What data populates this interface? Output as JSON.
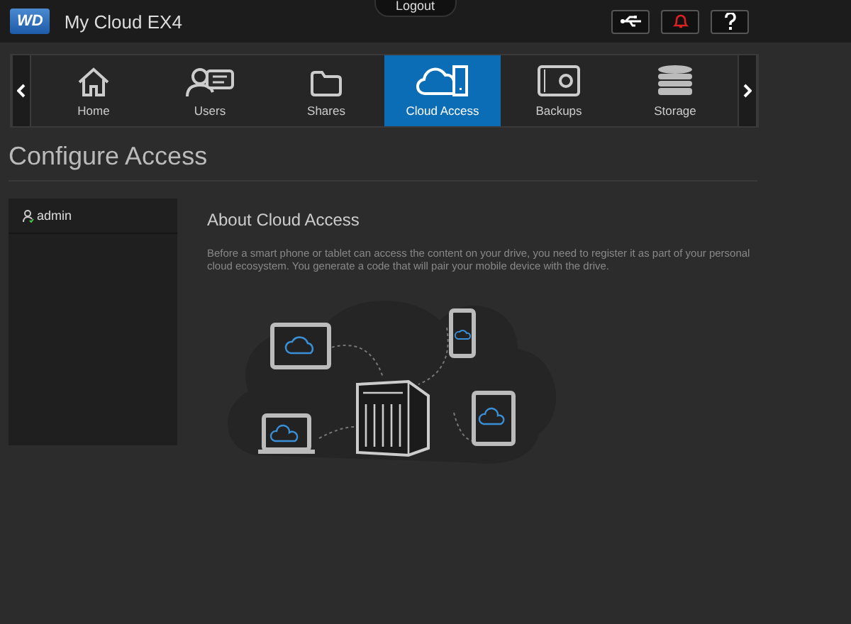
{
  "header": {
    "logo": "WD",
    "title": "My Cloud EX4",
    "logout": "Logout"
  },
  "nav": {
    "items": [
      {
        "label": "Home",
        "kind": "home",
        "selected": false
      },
      {
        "label": "Users",
        "kind": "users",
        "selected": false
      },
      {
        "label": "Shares",
        "kind": "shares",
        "selected": false
      },
      {
        "label": "Cloud Access",
        "kind": "cloud",
        "selected": true
      },
      {
        "label": "Backups",
        "kind": "backups",
        "selected": false
      },
      {
        "label": "Storage",
        "kind": "storage",
        "selected": false
      }
    ]
  },
  "page": {
    "title": "Configure Access"
  },
  "sidebar": {
    "items": [
      {
        "label": "admin",
        "selected": false
      }
    ]
  },
  "content": {
    "heading": "About Cloud Access",
    "text": "Before a smart phone or tablet can access the content on your drive, you need to register it as part of your personal cloud ecosystem. You generate a code that will pair your mobile device with the drive."
  }
}
